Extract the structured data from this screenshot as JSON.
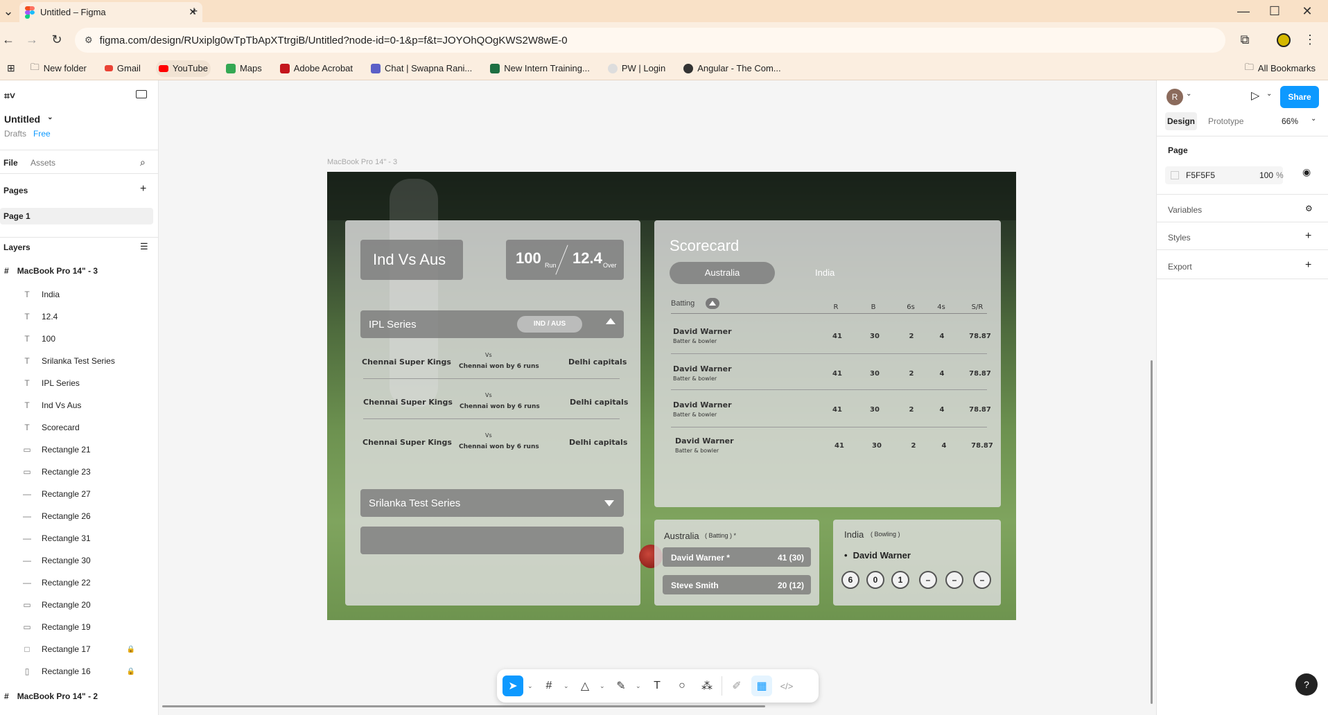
{
  "browser": {
    "tab_title": "Untitled – Figma",
    "url": "figma.com/design/RUxiplg0wTpTbApXTtrgiB/Untitled?node-id=0-1&p=f&t=JOYOhQOgKWS2W8wE-0",
    "bookmarks": [
      "New folder",
      "Gmail",
      "YouTube",
      "Maps",
      "Adobe Acrobat",
      "Chat | Swapna Rani...",
      "New Intern Training...",
      "PW | Login",
      "Angular - The Com..."
    ],
    "all_bookmarks": "All Bookmarks"
  },
  "left": {
    "file_name": "Untitled",
    "drafts": "Drafts",
    "plan": "Free",
    "tab_file": "File",
    "tab_assets": "Assets",
    "pages_label": "Pages",
    "page1": "Page 1",
    "layers_label": "Layers",
    "frame3": "MacBook Pro 14\" - 3",
    "frame2": "MacBook Pro 14\" - 2",
    "layers": [
      {
        "name": "India",
        "icon": "T"
      },
      {
        "name": "12.4",
        "icon": "T"
      },
      {
        "name": "100",
        "icon": "T"
      },
      {
        "name": "Srilanka Test Series",
        "icon": "T"
      },
      {
        "name": "IPL Series",
        "icon": "T"
      },
      {
        "name": "Ind Vs Aus",
        "icon": "T"
      },
      {
        "name": "Scorecard",
        "icon": "T"
      },
      {
        "name": "Rectangle 21",
        "icon": "▭"
      },
      {
        "name": "Rectangle 23",
        "icon": "▭"
      },
      {
        "name": "Rectangle 27",
        "icon": "—"
      },
      {
        "name": "Rectangle 26",
        "icon": "—"
      },
      {
        "name": "Rectangle 31",
        "icon": "—"
      },
      {
        "name": "Rectangle 30",
        "icon": "—"
      },
      {
        "name": "Rectangle 22",
        "icon": "—"
      },
      {
        "name": "Rectangle 20",
        "icon": "▭"
      },
      {
        "name": "Rectangle 19",
        "icon": "▭"
      },
      {
        "name": "Rectangle 17",
        "icon": "□",
        "locked": true
      },
      {
        "name": "Rectangle 16",
        "icon": "▯",
        "locked": true
      }
    ]
  },
  "canvas": {
    "frame_label": "MacBook Pro 14\" - 3",
    "match_title": "Ind Vs Aus",
    "runs": "100",
    "runs_unit": "Run",
    "overs": "12.4",
    "overs_unit": "Over",
    "ipl_title": "IPL Series",
    "ipl_badge": "IND / AUS",
    "matches": [
      {
        "team1": "Chennai Super Kings",
        "vs": "Vs",
        "result": "Chennai won by 6 runs",
        "team2": "Delhi capitals"
      },
      {
        "team1": "Chennai Super Kings",
        "vs": "Vs",
        "result": "Chennai won by 6 runs",
        "team2": "Delhi capitals"
      },
      {
        "team1": "Chennai Super Kings",
        "vs": "Vs",
        "result": "Chennai won by 6 runs",
        "team2": "Delhi capitals"
      }
    ],
    "srilanka_title": "Srilanka Test Series",
    "scorecard_title": "Scorecard",
    "sc_tab_active": "Australia",
    "sc_tab_other": "India",
    "batting_label": "Batting",
    "headers": [
      "R",
      "B",
      "6s",
      "4s",
      "S/R"
    ],
    "batsmen": [
      {
        "name": "David Warner",
        "role": "Batter & bowler",
        "r": "41",
        "b": "30",
        "s6": "2",
        "s4": "4",
        "sr": "78.87"
      },
      {
        "name": "David Warner",
        "role": "Batter & bowler",
        "r": "41",
        "b": "30",
        "s6": "2",
        "s4": "4",
        "sr": "78.87"
      },
      {
        "name": "David Warner",
        "role": "Batter & bowler",
        "r": "41",
        "b": "30",
        "s6": "2",
        "s4": "4",
        "sr": "78.87"
      },
      {
        "name": "David Warner",
        "role": "Batter & bowler",
        "r": "41",
        "b": "30",
        "s6": "2",
        "s4": "4",
        "sr": "78.87"
      }
    ],
    "aus_label": "Australia",
    "aus_sub": "( Batting ) *",
    "aus_players": [
      {
        "name": "David Warner *",
        "score": "41 (30)"
      },
      {
        "name": "Steve Smith",
        "score": "20 (12)"
      }
    ],
    "ind_label": "India",
    "ind_sub": "( Bowling )",
    "bowler": "David Warner",
    "balls": [
      "6",
      "0",
      "1",
      "–",
      "–",
      "–"
    ]
  },
  "right": {
    "avatar": "R",
    "share": "Share",
    "tab_design": "Design",
    "tab_prototype": "Prototype",
    "zoom": "66%",
    "page_label": "Page",
    "page_color": "F5F5F5",
    "page_opacity": "100",
    "pct": "%",
    "variables": "Variables",
    "styles": "Styles",
    "export": "Export"
  },
  "help": "?"
}
